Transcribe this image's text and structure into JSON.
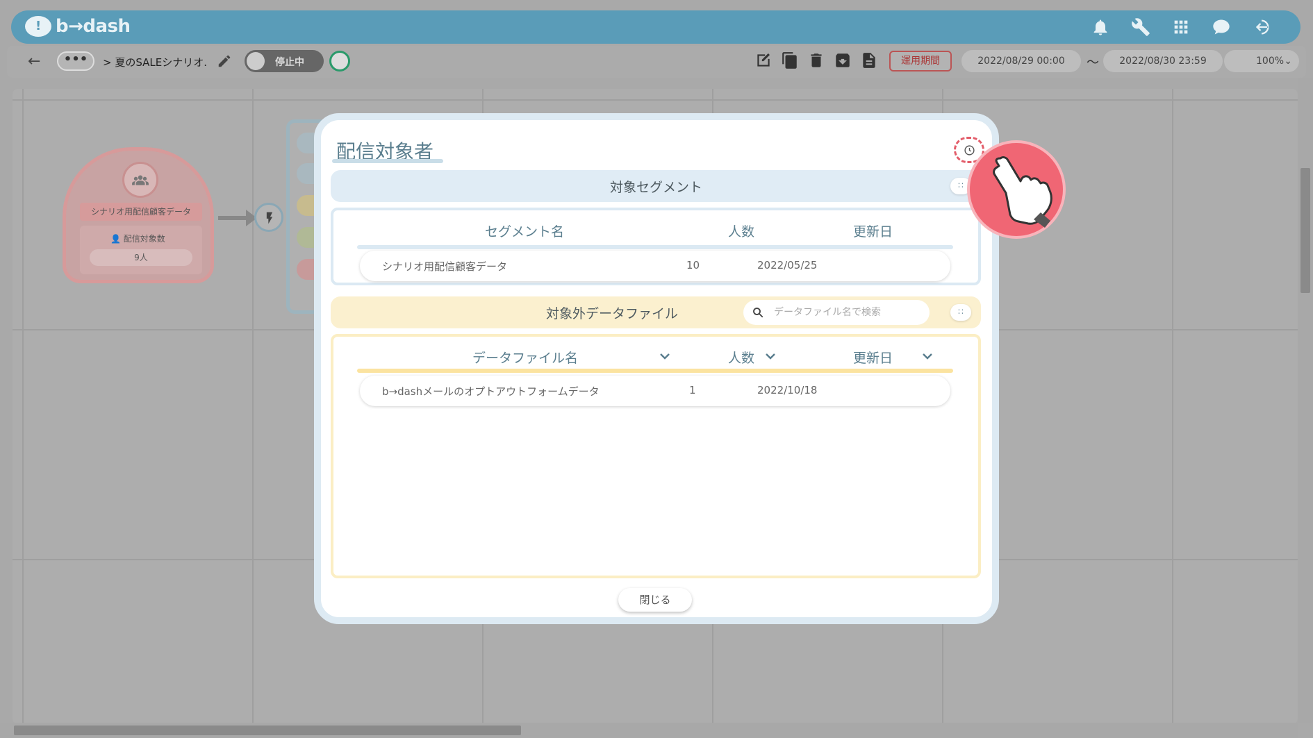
{
  "app": {
    "logo_text": "b→dash"
  },
  "header": {
    "icons": [
      "bell-icon",
      "wrench-icon",
      "apps-grid-icon",
      "chat-icon",
      "logout-icon"
    ]
  },
  "toolbar": {
    "breadcrumb": "> 夏のSALEシナリオ.",
    "toggle_label": "停止中",
    "period_label": "運用期間",
    "start_date": "2022/08/29 00:00",
    "tilde": "〜",
    "end_date": "2022/08/30 23:59",
    "zoom": "100%"
  },
  "canvas": {
    "node_title": "シナリオ用配信顧客データ",
    "node_count_label": "配信対象数",
    "node_count": "9人"
  },
  "modal": {
    "title": "配信対象者",
    "segment": {
      "title": "対象セグメント",
      "columns": [
        "セグメント名",
        "人数",
        "更新日"
      ],
      "rows": [
        {
          "name": "シナリオ用配信顧客データ",
          "count": "10",
          "date": "2022/05/25"
        }
      ]
    },
    "excluded": {
      "title": "対象外データファイル",
      "search_placeholder": "データファイル名で検索",
      "columns": [
        "データファイル名",
        "人数",
        "更新日"
      ],
      "rows": [
        {
          "name": "b→dashメールのオプトアウトフォームデータ",
          "count": "1",
          "date": "2022/10/18"
        }
      ]
    },
    "close_label": "閉じる"
  },
  "colors": {
    "header_bg": "#5a9cb8",
    "accent_red": "#e35d6a",
    "segment_header": "#e0ecf5",
    "excluded_header": "#fbf0cf"
  }
}
